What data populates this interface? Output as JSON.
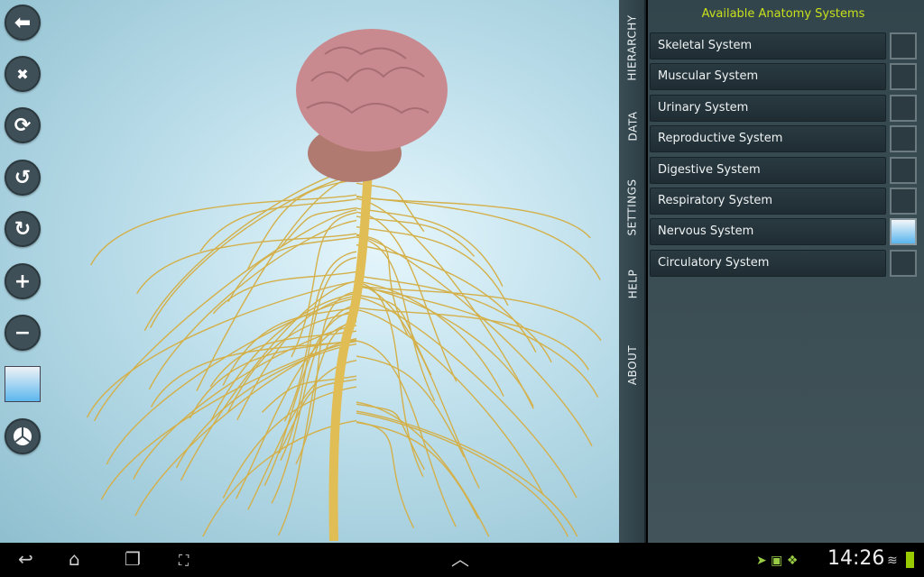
{
  "toolbar": {
    "buttons": [
      {
        "name": "back",
        "glyph": "⬅"
      },
      {
        "name": "close",
        "glyph": "✖"
      },
      {
        "name": "reset",
        "glyph": "⟳"
      },
      {
        "name": "rotate-left",
        "glyph": "↺"
      },
      {
        "name": "rotate-right",
        "glyph": "↻"
      },
      {
        "name": "zoom-in",
        "glyph": "+"
      },
      {
        "name": "zoom-out",
        "glyph": "−"
      }
    ],
    "background_color": "#5cb7ee"
  },
  "tabs": [
    "HIERARCHY",
    "DATA",
    "SETTINGS",
    "HELP",
    "ABOUT"
  ],
  "panel": {
    "title": "Available Anatomy Systems",
    "systems": [
      {
        "label": "Skeletal System",
        "checked": false
      },
      {
        "label": "Muscular System",
        "checked": false
      },
      {
        "label": "Urinary System",
        "checked": false
      },
      {
        "label": "Reproductive System",
        "checked": false
      },
      {
        "label": "Digestive System",
        "checked": false
      },
      {
        "label": "Respiratory System",
        "checked": false
      },
      {
        "label": "Nervous System",
        "checked": true
      },
      {
        "label": "Circulatory System",
        "checked": false
      }
    ]
  },
  "statusbar": {
    "time": "14:26"
  },
  "colors": {
    "accent": "#c8e01c",
    "nerve": "#d9b54a",
    "brain": "#c98a8f"
  }
}
